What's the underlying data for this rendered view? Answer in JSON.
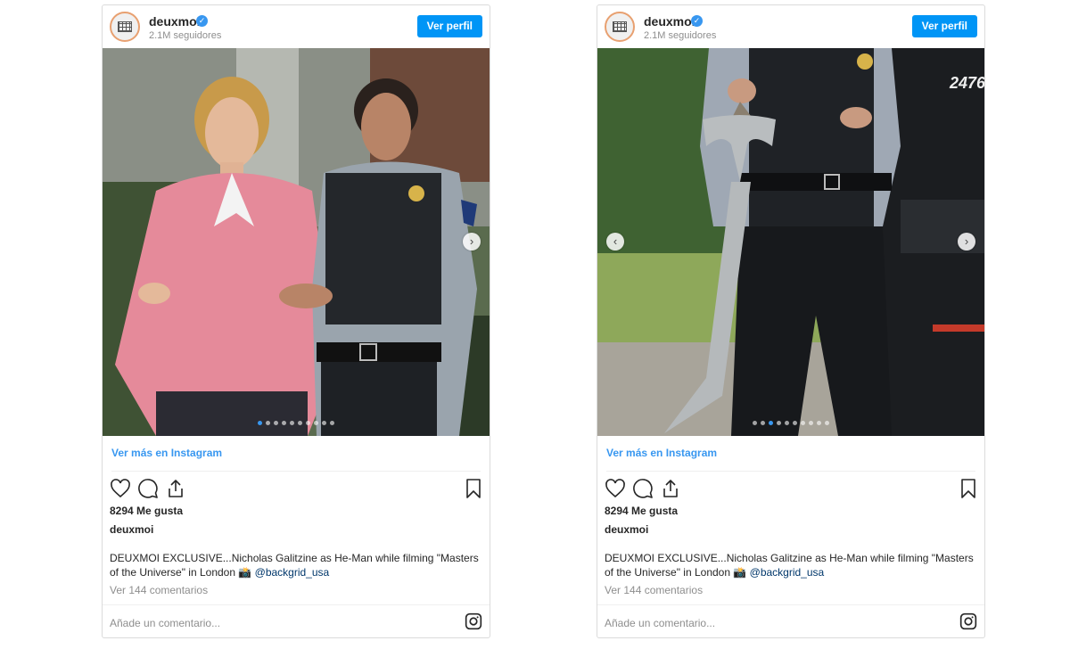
{
  "posts": [
    {
      "username": "deuxmoi",
      "followers": "2.1M seguidores",
      "profile_button": "Ver perfil",
      "more_link": "Ver más en Instagram",
      "likes": "8294 Me gusta",
      "author": "deuxmoi",
      "caption_text": "DEUXMOI EXCLUSIVE...Nicholas Galitzine as He-Man while filming \"Masters of the Universe\" in London 📸 ",
      "caption_handle": "@backgrid_usa",
      "comments": "Ver 144 comentarios",
      "add_comment": "Añade un comentario...",
      "carousel": {
        "total_slides": 10,
        "active_slide": 1,
        "arrows": [
          "next"
        ]
      }
    },
    {
      "username": "deuxmoi",
      "followers": "2.1M seguidores",
      "profile_button": "Ver perfil",
      "more_link": "Ver más en Instagram",
      "likes": "8294 Me gusta",
      "author": "deuxmoi",
      "caption_text": "DEUXMOI EXCLUSIVE...Nicholas Galitzine as He-Man while filming \"Masters of the Universe\" in London 📸 ",
      "caption_handle": "@backgrid_usa",
      "comments": "Ver 144 comentarios",
      "add_comment": "Añade un comentario...",
      "carousel": {
        "total_slides": 10,
        "active_slide": 3,
        "arrows": [
          "prev",
          "next"
        ]
      },
      "photo_text": "2476"
    }
  ],
  "colors": {
    "accent": "#0095f6",
    "link": "#3897f0",
    "muted": "#8e8e8e",
    "border": "#dbdbdb"
  },
  "icons": [
    "verified-badge-icon",
    "heart-icon",
    "comment-icon",
    "share-icon",
    "bookmark-icon",
    "instagram-icon",
    "chevron-left-icon",
    "chevron-right-icon"
  ]
}
